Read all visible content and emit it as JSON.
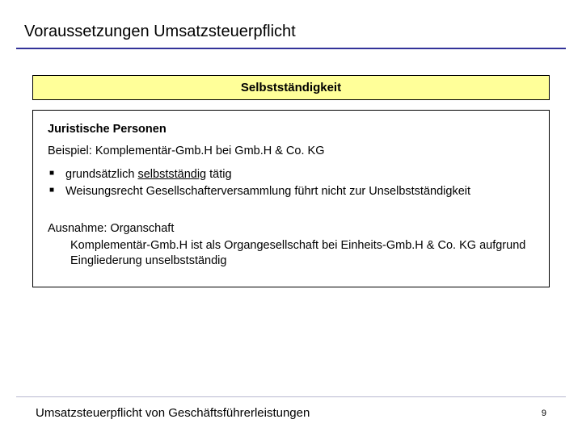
{
  "title": "Voraussetzungen Umsatzsteuerpflicht",
  "yellow_box": "Selbstständigkeit",
  "content": {
    "subheading": "Juristische Personen",
    "example": "Beispiel: Komplementär-Gmb.H bei Gmb.H & Co. KG",
    "bullet1_pre": "grundsätzlich ",
    "bullet1_underlined": "selbstständig",
    "bullet1_post": " tätig",
    "bullet2": "Weisungsrecht Gesellschafterversammlung führt nicht zur Unselbstständigkeit",
    "ausnahme_label": "Ausnahme: Organschaft",
    "ausnahme_text": "Komplementär-Gmb.H ist als Organgesellschaft bei Einheits-Gmb.H & Co. KG aufgrund Eingliederung unselbstständig"
  },
  "footer": {
    "text": "Umsatzsteuerpflicht von Geschäftsführerleistungen",
    "page": "9"
  }
}
